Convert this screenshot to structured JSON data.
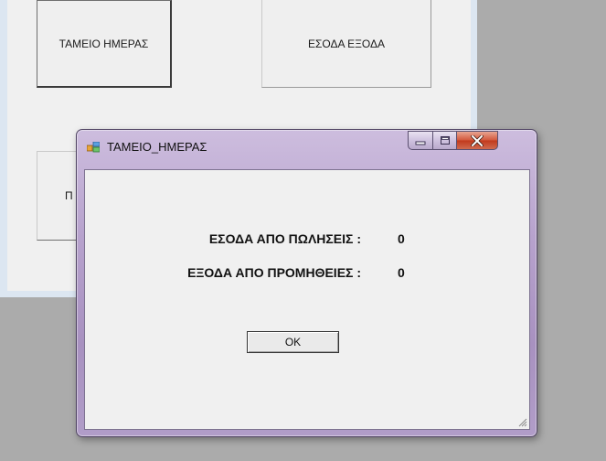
{
  "parent": {
    "buttons": [
      {
        "label": "ΤΑΜΕΙΟ ΗΜΕΡΑΣ"
      },
      {
        "label": "ΕΣΟΔΑ ΕΞΟΔΑ"
      },
      {
        "label": "Π"
      }
    ]
  },
  "dialog": {
    "title": "ΤΑΜΕΙΟ_ΗΜΕΡΑΣ",
    "income_label": "ΕΣΟΔΑ ΑΠΟ ΠΩΛΗΣΕΙΣ :",
    "income_value": "0",
    "expense_label": "ΕΞΟΔΑ ΑΠΟ ΠΡΟΜΗΘΕΙΕΣ :",
    "expense_value": "0",
    "ok_label": "OK"
  },
  "icons": {
    "app": "app-window-icon",
    "minimize": "minimize-icon",
    "maximize": "maximize-icon",
    "close": "close-icon",
    "grip": "resize-grip-icon"
  },
  "colors": {
    "close_button": "#c8472a",
    "titlebar": "#b7a2cd",
    "desktop": "#ababab"
  }
}
